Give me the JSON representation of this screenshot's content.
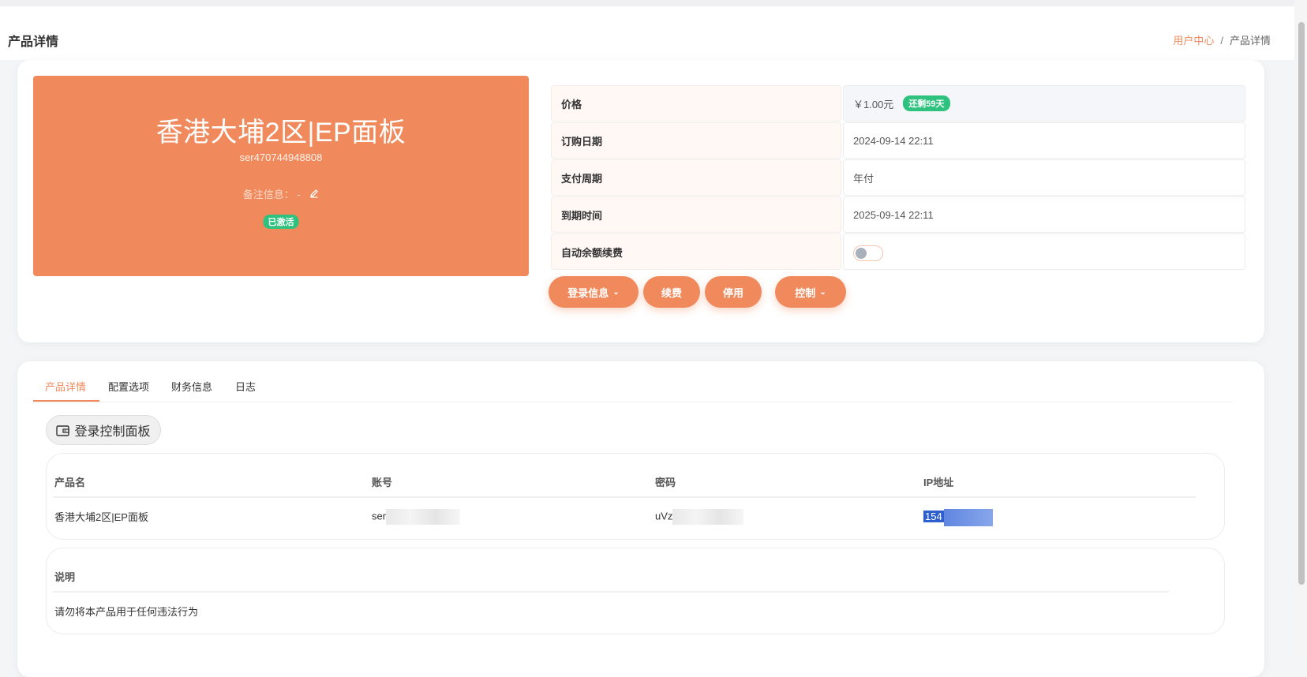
{
  "header": {
    "page_title": "产品详情",
    "breadcrumb": {
      "home": "用户中心",
      "separator": "/",
      "current": "产品详情"
    }
  },
  "product": {
    "name": "香港大埔2区|EP面板",
    "id": "ser470744948808",
    "remark_label": "备注信息：",
    "remark_value": "-",
    "status_badge": "已激活"
  },
  "info": {
    "price_label": "价格",
    "price_value": "￥1.00元",
    "remaining_badge": "还剩59天",
    "order_date_label": "订购日期",
    "order_date_value": "2024-09-14 22:11",
    "pay_cycle_label": "支付周期",
    "pay_cycle_value": "年付",
    "expire_label": "到期时间",
    "expire_value": "2025-09-14 22:11",
    "auto_renew_label": "自动余额续费",
    "auto_renew_on": false
  },
  "actions": {
    "login_info": "登录信息",
    "renew": "续费",
    "disable": "停用",
    "control": "控制"
  },
  "tabs": [
    "产品详情",
    "配置选项",
    "财务信息",
    "日志"
  ],
  "active_tab": "产品详情",
  "panel_button": "登录控制面板",
  "detail_table": {
    "headers": [
      "产品名",
      "账号",
      "密码",
      "IP地址"
    ],
    "row": {
      "product_name": "香港大埔2区|EP面板",
      "account_prefix": "ser",
      "password_prefix": "uVz",
      "ip_prefix": "154"
    }
  },
  "description": {
    "title": "说明",
    "text": "请勿将本产品用于任何违法行为"
  },
  "colors": {
    "accent": "#f08a5d",
    "success": "#2ec27e",
    "ip_selection": "#2f5fce"
  }
}
